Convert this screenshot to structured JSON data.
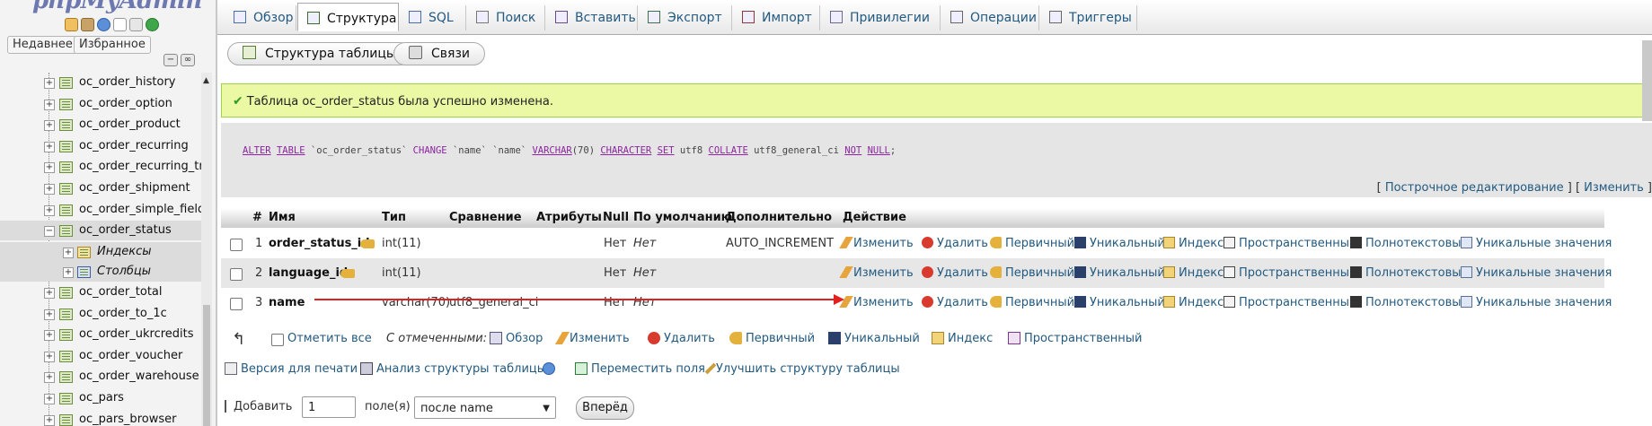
{
  "sidebar": {
    "logo_text": "phpMyAdmin",
    "recent_label": "Недавнее",
    "favorites_label": "Избранное",
    "tables": [
      {
        "name": "oc_order_history"
      },
      {
        "name": "oc_order_option"
      },
      {
        "name": "oc_order_product"
      },
      {
        "name": "oc_order_recurring"
      },
      {
        "name": "oc_order_recurring_tra"
      },
      {
        "name": "oc_order_shipment"
      },
      {
        "name": "oc_order_simple_fields"
      },
      {
        "name": "oc_order_status",
        "selected": true
      },
      {
        "name": "oc_order_total"
      },
      {
        "name": "oc_order_to_1c"
      },
      {
        "name": "oc_order_ukrcredits"
      },
      {
        "name": "oc_order_voucher"
      },
      {
        "name": "oc_order_warehouse"
      },
      {
        "name": "oc_pars"
      },
      {
        "name": "oc_pars_browser"
      }
    ],
    "sub_items": [
      "Индексы",
      "Столбцы"
    ]
  },
  "topnav": {
    "tabs": [
      {
        "label": "Обзор",
        "icon": "browse-icon"
      },
      {
        "label": "Структура",
        "icon": "structure-icon",
        "active": true
      },
      {
        "label": "SQL",
        "icon": "sql-icon"
      },
      {
        "label": "Поиск",
        "icon": "search-icon"
      },
      {
        "label": "Вставить",
        "icon": "insert-icon"
      },
      {
        "label": "Экспорт",
        "icon": "export-icon"
      },
      {
        "label": "Импорт",
        "icon": "import-icon"
      },
      {
        "label": "Привилегии",
        "icon": "privileges-icon"
      },
      {
        "label": "Операции",
        "icon": "wrench-icon"
      },
      {
        "label": "Триггеры",
        "icon": "triggers-icon"
      }
    ]
  },
  "subtabs": {
    "table_structure": "Структура таблицы",
    "relations": "Связи"
  },
  "message": {
    "success": "Таблица oc_order_status была успешно изменена."
  },
  "sql": {
    "kw_alter": "ALTER",
    "kw_table": "TABLE",
    "table_name": "`oc_order_status`",
    "kw_change": "CHANGE",
    "col_old": "`name`",
    "col_new": "`name`",
    "kw_varchar": "VARCHAR",
    "len": "(70)",
    "kw_character": "CHARACTER",
    "kw_set": "SET",
    "charset": "utf8",
    "kw_collate": "COLLATE",
    "collation": "utf8_general_ci",
    "kw_not": "NOT",
    "kw_null": "NULL",
    "end": ";",
    "inline_edit": "Построчное редактирование",
    "edit": "Изменить"
  },
  "table": {
    "headers": {
      "num": "#",
      "name": "Имя",
      "type": "Тип",
      "collation": "Сравнение",
      "attributes": "Атрибуты",
      "null": "Null",
      "default": "По умолчанию",
      "extra": "Дополнительно",
      "action": "Действие"
    },
    "rows": [
      {
        "num": "1",
        "name": "order_status_id",
        "type": "int(11)",
        "collation": "",
        "null": "Нет",
        "default": "Нет",
        "extra": "AUTO_INCREMENT",
        "key": true
      },
      {
        "num": "2",
        "name": "language_id",
        "type": "int(11)",
        "collation": "",
        "null": "Нет",
        "default": "Нет",
        "extra": "",
        "key": true
      },
      {
        "num": "3",
        "name": "name",
        "type": "varchar(70)",
        "collation": "utf8_general_ci",
        "null": "Нет",
        "default": "Нет",
        "extra": "",
        "key": false
      }
    ],
    "row_actions": {
      "change": "Изменить",
      "drop": "Удалить",
      "primary": "Первичный",
      "unique": "Уникальный",
      "index": "Индекс",
      "spatial": "Пространственный",
      "fulltext": "Полнотекстовый",
      "distinct": "Уникальные значения"
    }
  },
  "bulk": {
    "check_all": "Отметить все",
    "with_selected": "С отмеченными:",
    "browse": "Обзор",
    "change": "Изменить",
    "drop": "Удалить",
    "primary": "Первичный",
    "unique": "Уникальный",
    "index": "Индекс",
    "spatial": "Пространственный"
  },
  "footer_links": {
    "print": "Версия для печати",
    "analyze": "Анализ структуры таблицы",
    "move": "Переместить поля",
    "improve": "Улучшить структуру таблицы"
  },
  "add_fields": {
    "label": "Добавить",
    "count": "1",
    "fields_label": "поле(я)",
    "position": "после name",
    "go": "Вперёд"
  },
  "colors": {
    "link": "#235a81",
    "success_bg": "#ebf8a4",
    "success_border": "#a2d246",
    "annotation_arrow": "#e32020"
  }
}
